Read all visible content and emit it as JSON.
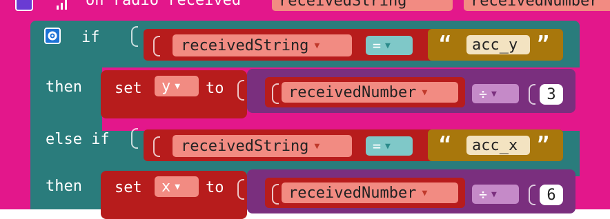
{
  "event": {
    "label": "on radio received",
    "param1": "receivedString",
    "param2": "receivedNumber"
  },
  "if_block": {
    "if_label": "if",
    "then_label": "then",
    "else_if_label": "else if"
  },
  "conditions": [
    {
      "var": "receivedString",
      "op": "=",
      "text": "acc_y"
    },
    {
      "var": "receivedString",
      "op": "=",
      "text": "acc_x"
    }
  ],
  "actions": [
    {
      "set": "set",
      "target": "y",
      "to": "to",
      "var": "receivedNumber",
      "op": "÷",
      "value": "3"
    },
    {
      "set": "set",
      "target": "x",
      "to": "to",
      "var": "receivedNumber",
      "op": "÷",
      "value": "6"
    }
  ],
  "quotes": {
    "open": "“",
    "close": "”"
  },
  "colors": {
    "event": "#e3178b",
    "logic": "#2a7c7c",
    "variable": "#b71c1c",
    "variable_pill": "#f28b82",
    "compare_pill": "#7fc8c8",
    "text": "#a8770c",
    "math": "#7a2f7e",
    "math_pill": "#c58ac8"
  }
}
